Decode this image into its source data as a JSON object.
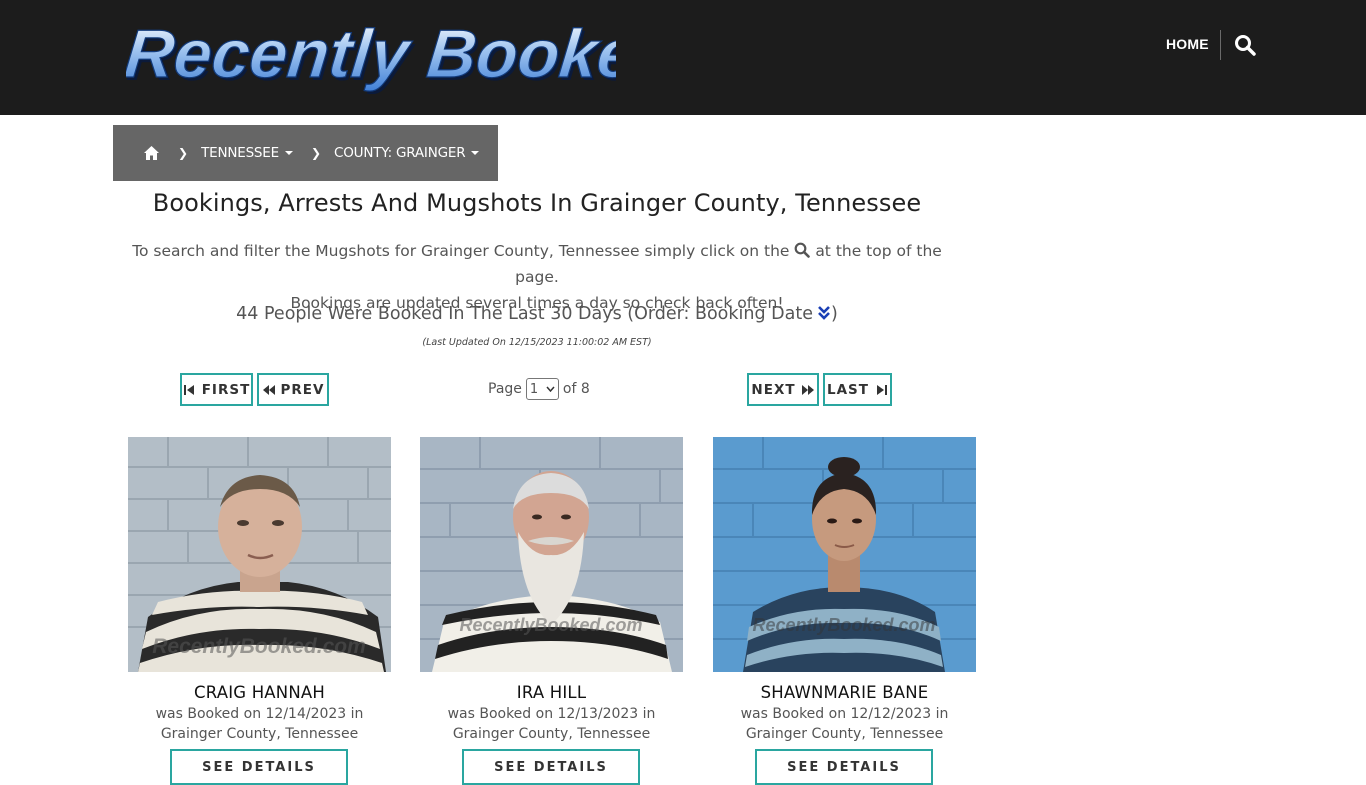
{
  "header": {
    "logo_text": "Recently Booked",
    "nav_home": "HOME",
    "search_icon": "search-icon"
  },
  "breadcrumb": {
    "home_icon": "home-icon",
    "state": "TENNESSEE",
    "county": "COUNTY: GRAINGER"
  },
  "main": {
    "title": "Bookings, Arrests And Mugshots In Grainger County, Tennessee",
    "intro_before_icon": "To search and filter the Mugshots for Grainger County, Tennessee simply click on the",
    "intro_after_icon": "at the top of the page.",
    "intro_line2": "Bookings are updated several times a day so check back often!",
    "count_text": "44 People Were Booked In The Last 30 Days (Order: Booking Date",
    "count_close": ")",
    "updated": "(Last Updated On 12/15/2023 11:00:02 AM EST)"
  },
  "pagination": {
    "first": "FIRST",
    "prev": "PREV",
    "next": "NEXT",
    "last": "LAST",
    "page_label": "Page",
    "page_value": "1",
    "of_label": "of 8"
  },
  "colors": {
    "header_bg": "#1c1c1c",
    "breadcrumb_bg": "#666666",
    "accent": "#2aa6a0",
    "order_icon": "#1a3fb5"
  },
  "bookings": [
    {
      "name": "CRAIG HANNAH",
      "line1": "was Booked on 12/14/2023 in",
      "line2": "Grainger County, Tennessee",
      "button": "SEE DETAILS",
      "watermark": "RecentlyBooked.com"
    },
    {
      "name": "IRA HILL",
      "line1": "was Booked on 12/13/2023 in",
      "line2": "Grainger County, Tennessee",
      "button": "SEE DETAILS",
      "watermark": "RecentlyBooked.com"
    },
    {
      "name": "SHAWNMARIE BANE",
      "line1": "was Booked on 12/12/2023 in",
      "line2": "Grainger County, Tennessee",
      "button": "SEE DETAILS",
      "watermark": "RecentlyBooked.com"
    }
  ]
}
